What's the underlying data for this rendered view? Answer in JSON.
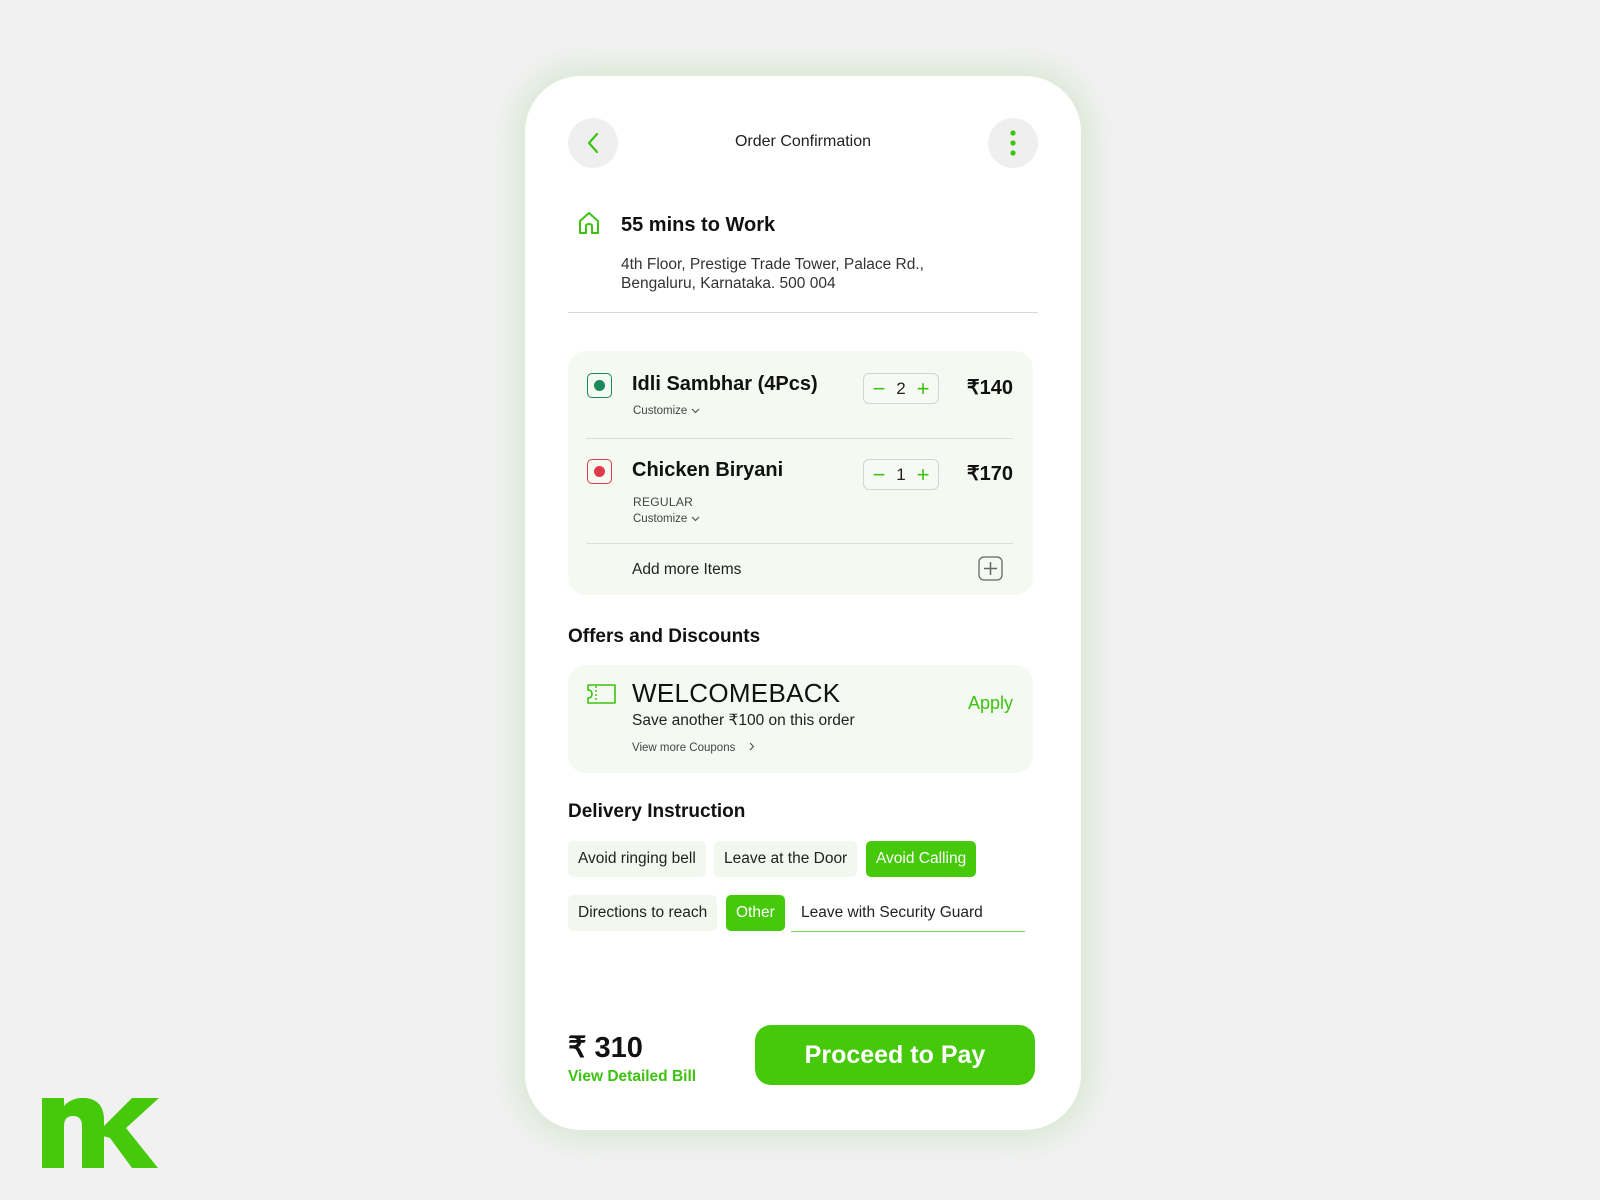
{
  "header": {
    "title": "Order Confirmation",
    "back_icon": "chevron-left-icon",
    "menu_icon": "more-vertical-icon"
  },
  "address": {
    "icon": "home-icon",
    "title": "55 mins to Work",
    "line1": "4th Floor, Prestige Trade Tower, Palace Rd.,",
    "line2": "Bengaluru, Karnataka. 500 004"
  },
  "cart": {
    "items": [
      {
        "name": "Idli Sambhar (4Pcs)",
        "type": "veg",
        "variant": "",
        "customize_label": "Customize",
        "quantity": "2",
        "price": "₹140"
      },
      {
        "name": "Chicken Biryani",
        "type": "non-veg",
        "variant": "REGULAR",
        "customize_label": "Customize",
        "quantity": "1",
        "price": "₹170"
      }
    ],
    "add_more_label": "Add more Items"
  },
  "offers": {
    "section_title": "Offers and Discounts",
    "code": "WELCOMEBACK",
    "description": "Save another ₹100 on this order",
    "view_more_label": "View more Coupons",
    "apply_label": "Apply"
  },
  "delivery": {
    "section_title": "Delivery Instruction",
    "options": [
      {
        "label": "Avoid ringing bell",
        "selected": false
      },
      {
        "label": "Leave at the Door",
        "selected": false
      },
      {
        "label": "Avoid Calling",
        "selected": true
      },
      {
        "label": "Directions to reach",
        "selected": false
      },
      {
        "label": "Other",
        "selected": true
      }
    ],
    "other_value": "Leave with Security Guard"
  },
  "footer": {
    "total": "₹ 310",
    "view_bill_label": "View Detailed Bill",
    "pay_label": "Proceed to Pay"
  },
  "colors": {
    "accent": "#45c90a",
    "veg": "#1a8a5a",
    "non_veg": "#e0394a",
    "card_bg": "#f4f9f1"
  },
  "brand": {
    "logo_text": "nk"
  }
}
